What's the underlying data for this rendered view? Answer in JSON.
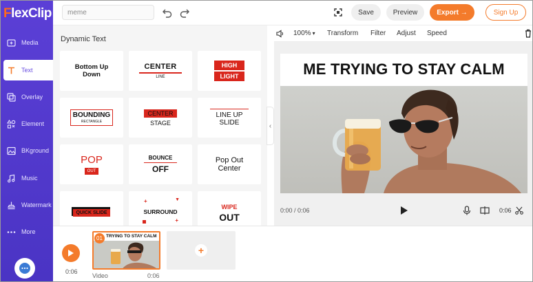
{
  "app": {
    "logo_prefix": "F",
    "logo_rest": "lexClip"
  },
  "sidebar": {
    "items": [
      {
        "label": "Media",
        "icon": "media-icon"
      },
      {
        "label": "Text",
        "icon": "text-icon"
      },
      {
        "label": "Overlay",
        "icon": "overlay-icon"
      },
      {
        "label": "Element",
        "icon": "element-icon"
      },
      {
        "label": "BKground",
        "icon": "background-icon"
      },
      {
        "label": "Music",
        "icon": "music-icon"
      },
      {
        "label": "Watermark",
        "icon": "watermark-icon"
      },
      {
        "label": "More",
        "icon": "more-icon"
      }
    ],
    "active": "Text"
  },
  "topbar": {
    "search_value": "meme",
    "save_label": "Save",
    "preview_label": "Preview",
    "export_label": "Export →",
    "signup_label": "Sign Up"
  },
  "panel": {
    "title": "Dynamic Text",
    "cards": {
      "bottom_up": "Bottom Up Down",
      "center": "CENTER",
      "center_sub": "LINE",
      "high": "HIGH",
      "light": "LIGHT",
      "bounding": "BOUNDING",
      "bounding_sub": "RECTANGLE",
      "center_stage_1": "CENTER",
      "center_stage_2": "STAGE",
      "line_up_1": "LINE UP",
      "line_up_2": "SLIDE",
      "pop": "POP",
      "pop_sub": "OUT",
      "bounce": "BOUNCE",
      "bounce_sub": "OFF",
      "pop_out_1": "Pop Out",
      "pop_out_2": "Center",
      "quick_slide": "QUICK SLIDE",
      "surround": "SURROUND",
      "wipe": "WIPE",
      "wipe_sub": "OUT"
    }
  },
  "preview_toolbar": {
    "zoom": "100%",
    "transform": "Transform",
    "filter": "Filter",
    "adjust": "Adjust",
    "speed": "Speed"
  },
  "preview": {
    "caption": "ME TRYING TO STAY CALM",
    "time_current": "0:00 / 0:06",
    "duration": "0:06"
  },
  "timeline": {
    "total_time": "0:06",
    "clip_number": "01",
    "clip_caption": "TRYING TO STAY CALM",
    "clip_type": "Video",
    "clip_duration": "0:06"
  },
  "colors": {
    "sidebar": "#5b3fd6",
    "accent": "#f47b2b",
    "text_red": "#d9261c"
  }
}
